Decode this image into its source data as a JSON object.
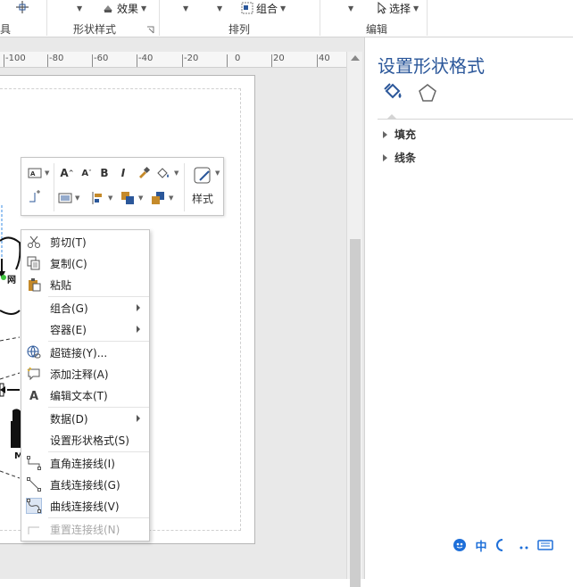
{
  "ribbon": {
    "effects_label": "效果",
    "group_label_partial": "具",
    "group_shape_styles": "形状样式",
    "group_arrange": "排列",
    "group_combine_label": "组合",
    "group_edit": "编辑",
    "select_label": "选择"
  },
  "ruler": {
    "ticks": [
      "-100",
      "-80",
      "-60",
      "-40",
      "-20",
      "0",
      "20",
      "40"
    ]
  },
  "mini_toolbar": {
    "style_label": "样式",
    "font_grow": "A",
    "font_shrink": "A",
    "bold": "B",
    "italic": "I"
  },
  "context_menu": {
    "items": [
      {
        "label": "剪切(T)",
        "icon": "scissors-icon"
      },
      {
        "label": "复制(C)",
        "icon": "copy-icon"
      },
      {
        "label": "粘贴",
        "icon": "paste-icon"
      },
      {
        "label": "组合(G)",
        "icon": "",
        "submenu": true
      },
      {
        "label": "容器(E)",
        "icon": "",
        "submenu": true
      },
      {
        "label": "超链接(Y)...",
        "icon": "hyperlink-icon"
      },
      {
        "label": "添加注释(A)",
        "icon": "add-comment-icon"
      },
      {
        "label": "编辑文本(T)",
        "icon": "edit-text-icon"
      },
      {
        "label": "数据(D)",
        "icon": "",
        "submenu": true
      },
      {
        "label": "设置形状格式(S)",
        "icon": ""
      },
      {
        "label": "直角连接线(I)",
        "icon": "right-angle-connector-icon"
      },
      {
        "label": "直线连接线(G)",
        "icon": "straight-connector-icon"
      },
      {
        "label": "曲线连接线(V)",
        "icon": "curved-connector-icon"
      },
      {
        "label": "重置连接线(N)",
        "icon": "reset-connector-icon",
        "disabled": true
      }
    ]
  },
  "format_pane": {
    "title": "设置形状格式",
    "sections": [
      "填充",
      "线条"
    ]
  },
  "diagram": {
    "frag_label_1": "网",
    "frag_label_2": "M"
  },
  "ime": {
    "zh_label": "中"
  },
  "colors": {
    "accent": "#2b579a",
    "ime_blue": "#1e6fd9"
  }
}
